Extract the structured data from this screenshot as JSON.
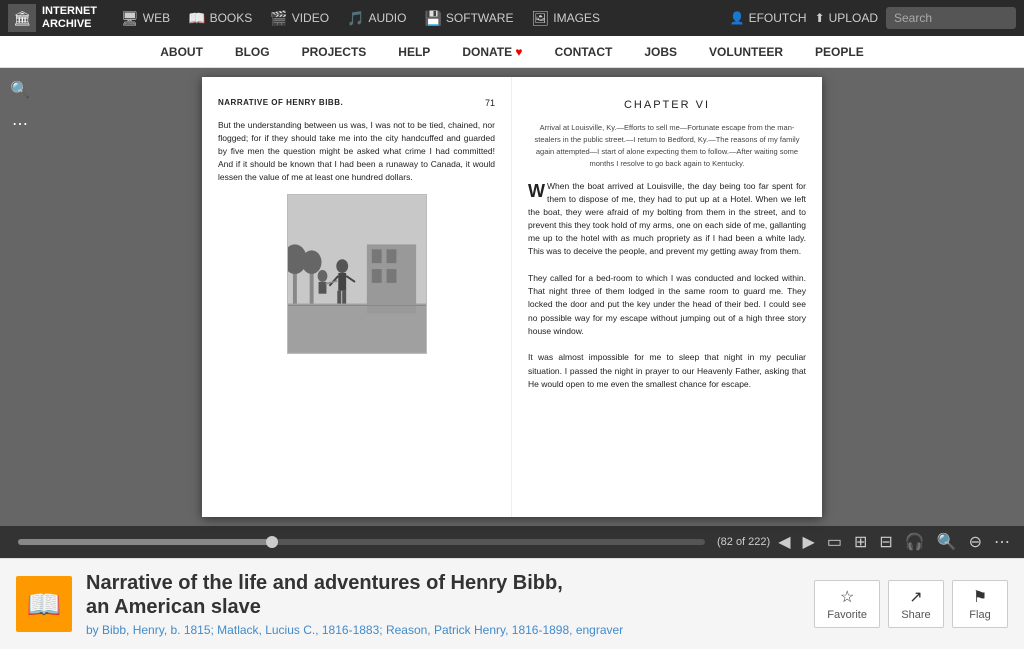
{
  "topnav": {
    "logo_line1": "INTERNET",
    "logo_line2": "ARCHIVE",
    "nav_items": [
      {
        "id": "web",
        "icon": "🖥",
        "label": "WEB"
      },
      {
        "id": "books",
        "icon": "📖",
        "label": "BOOKS"
      },
      {
        "id": "video",
        "icon": "🎬",
        "label": "VIDEO"
      },
      {
        "id": "audio",
        "icon": "🎵",
        "label": "AUDIO"
      },
      {
        "id": "software",
        "icon": "💾",
        "label": "SOFTWARE"
      },
      {
        "id": "images",
        "icon": "🖼",
        "label": "IMAGES"
      }
    ],
    "user_label": "EFOUTCH",
    "upload_label": "UPLOAD",
    "search_placeholder": "Search"
  },
  "secondnav": {
    "items": [
      {
        "id": "about",
        "label": "ABOUT"
      },
      {
        "id": "blog",
        "label": "BLOG"
      },
      {
        "id": "projects",
        "label": "PROJECTS"
      },
      {
        "id": "help",
        "label": "HELP"
      },
      {
        "id": "donate",
        "label": "DONATE"
      },
      {
        "id": "contact",
        "label": "CONTACT"
      },
      {
        "id": "jobs",
        "label": "JOBS"
      },
      {
        "id": "volunteer",
        "label": "VOLUNTEER"
      },
      {
        "id": "people",
        "label": "PEOPLE"
      }
    ]
  },
  "book": {
    "left_page": {
      "header_title": "NARRATIVE OF HENRY BIBB.",
      "header_page": "71",
      "body": "But the understanding between us was, I was not to be tied, chained, nor flogged; for if they should take me into the city handcuffed and guarded by five men the question might be asked what crime I had committed! And if it should be known that I had been a runaway to Canada, it would lessen the value of me at least one hundred dollars."
    },
    "right_page": {
      "chapter_title": "CHAPTER VI",
      "chapter_subtitle": "Arrival at Louisville, Ky.—Efforts to sell me—Fortunate escape from the man-stealers in the public street.—I return to Bedford, Ky.—The reasons of my family again attempted—I start of alone expecting them to follow.—After waiting some months I resolve to go back again to Kentucky.",
      "body_part1": "When the boat arrived at Louisville, the day being too far spent for them to dispose of me, they had to put up at a Hotel. When we left the boat, they were afraid of my bolting from them in the street, and to prevent this they took hold of my arms, one on each side of me, gallanting me up to the hotel with as much propriety as if I had been a white lady. This was to deceive the people, and prevent my getting away from them.",
      "body_part2": "They called for a bed-room to which I was conducted and locked within. That night three of them lodged in the same room to guard me. They locked the door and put the key under the head of their bed. I could see no possible way for my escape without jumping out of a high three story house window.",
      "body_part3": "It was almost impossible for me to sleep that night in my peculiar situation. I passed the night in prayer to our Heavenly Father, asking that He would open to me even the smallest chance for escape."
    }
  },
  "toolbar": {
    "page_info": "(82 of 222)",
    "progress_percent": 37
  },
  "bottom_info": {
    "book_title": "Narrative of the life and adventures of Henry Bibb,",
    "book_subtitle": "an American slave",
    "authors": "by Bibb, Henry, b. 1815; Matlack, Lucius C., 1816-1883; Reason, Patrick Henry, 1816-1898, engraver",
    "favorite_label": "Favorite",
    "share_label": "Share",
    "flag_label": "Flag"
  }
}
